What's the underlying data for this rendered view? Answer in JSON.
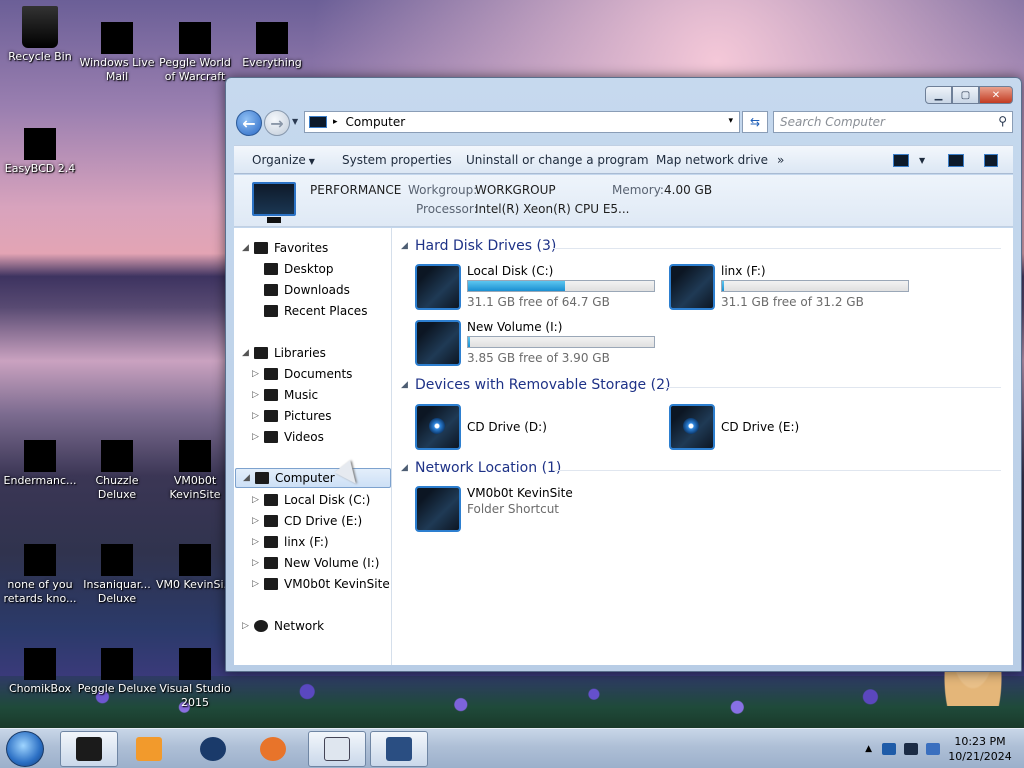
{
  "desktop": {
    "icons": [
      {
        "label": "Recycle Bin",
        "name": "recycle-bin-icon"
      },
      {
        "label": "Windows Live Mail",
        "name": "windows-live-mail-icon"
      },
      {
        "label": "Peggle World of Warcraft",
        "name": "peggle-wow-icon"
      },
      {
        "label": "Everything",
        "name": "everything-icon"
      },
      {
        "label": "EasyBCD 2.4",
        "name": "easybcd-icon"
      },
      {
        "label": "Endermanc...",
        "name": "endermanc-icon"
      },
      {
        "label": "Chuzzle Deluxe",
        "name": "chuzzle-icon"
      },
      {
        "label": "VM0b0t KevinSite",
        "name": "vm0b0t-kevinsite-icon"
      },
      {
        "label": "none of you retards kno...",
        "name": "none-of-you-icon"
      },
      {
        "label": "Insaniquar... Deluxe",
        "name": "insaniquarium-icon"
      },
      {
        "label": "VM0 KevinSi...",
        "name": "vm0-kevinsite-icon"
      },
      {
        "label": "ChomikBox",
        "name": "chomikbox-icon"
      },
      {
        "label": "Peggle Deluxe",
        "name": "peggle-deluxe-icon"
      },
      {
        "label": "Visual Studio 2015",
        "name": "visual-studio-icon"
      }
    ]
  },
  "window": {
    "caption": {
      "minimize": "▁",
      "maximize": "▢",
      "close": "✕"
    },
    "address": {
      "path": "Computer",
      "separator": "▸",
      "dropdown": "▾"
    },
    "search_placeholder": "Search Computer",
    "toolbar": {
      "organize": "Organize",
      "system_properties": "System properties",
      "uninstall": "Uninstall or change a program",
      "map_network": "Map network drive",
      "more": "»"
    },
    "details": {
      "computer_name": "PERFORMANCE",
      "workgroup_label": "Workgroup:",
      "workgroup": "WORKGROUP",
      "memory_label": "Memory:",
      "memory": "4.00 GB",
      "processor_label": "Processor:",
      "processor": "Intel(R) Xeon(R) CPU E5..."
    },
    "navpane": {
      "favorites": "Favorites",
      "desktop": "Desktop",
      "downloads": "Downloads",
      "recent": "Recent Places",
      "libraries": "Libraries",
      "documents": "Documents",
      "music": "Music",
      "pictures": "Pictures",
      "videos": "Videos",
      "computer": "Computer",
      "local_disk": "Local Disk (C:)",
      "cd_drive": "CD Drive (E:)",
      "linx": "linx (F:)",
      "new_volume": "New Volume (I:)",
      "vm0b0t": "VM0b0t KevinSite",
      "network": "Network"
    },
    "groups": {
      "hdd": "Hard Disk Drives (3)",
      "removable": "Devices with Removable Storage (2)",
      "network": "Network Location (1)"
    },
    "drives": {
      "c": {
        "name": "Local Disk (C:)",
        "free": "31.1 GB free of 64.7 GB",
        "used_fraction": 0.52
      },
      "f": {
        "name": "linx (F:)",
        "free": "31.1 GB free of 31.2 GB",
        "used_fraction": 0.003
      },
      "i": {
        "name": "New Volume (I:)",
        "free": "3.85 GB free of 3.90 GB",
        "used_fraction": 0.013
      },
      "d": {
        "name": "CD Drive (D:)"
      },
      "e": {
        "name": "CD Drive (E:)"
      },
      "net": {
        "name": "VM0b0t KevinSite",
        "type": "Folder Shortcut"
      }
    }
  },
  "taskbar": {
    "time": "10:23 PM",
    "date": "10/21/2024",
    "tray_up": "▲"
  }
}
